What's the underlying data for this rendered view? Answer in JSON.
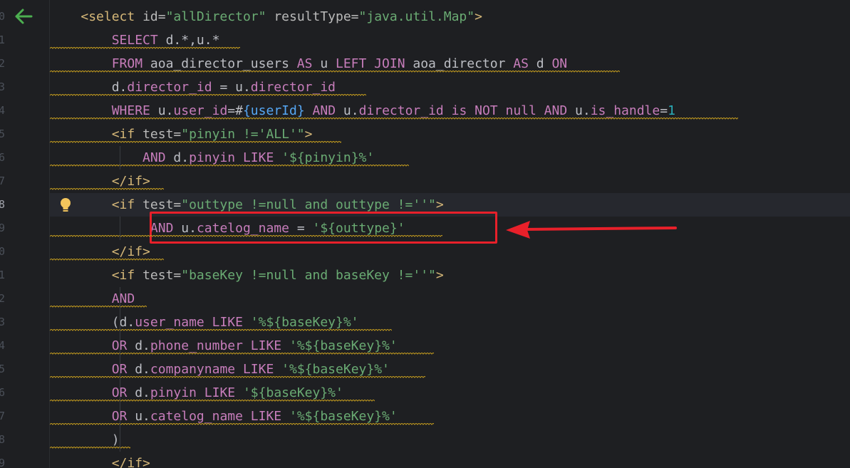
{
  "editor": {
    "current_line_index": 8,
    "gutter_numbers": [
      "0",
      "1",
      "2",
      "3",
      "4",
      "5",
      "6",
      "7",
      "8",
      "9",
      "0",
      "1",
      "2",
      "3",
      "4",
      "5",
      "6",
      "7",
      "8",
      "9"
    ],
    "lines": [
      {
        "indent": "    ",
        "tokens": [
          {
            "c": "tag",
            "t": "<select "
          },
          {
            "c": "attr",
            "t": "id="
          },
          {
            "c": "val",
            "t": "\"allDirector\""
          },
          {
            "c": "txt",
            "t": " "
          },
          {
            "c": "attr",
            "t": "resultType="
          },
          {
            "c": "val",
            "t": "\"java.util.Map\""
          },
          {
            "c": "tag",
            "t": ">"
          }
        ]
      },
      {
        "indent": "        ",
        "tokens": [
          {
            "c": "sqlkw",
            "t": "SELECT "
          },
          {
            "c": "txt",
            "t": "d.*,u.*"
          }
        ]
      },
      {
        "indent": "        ",
        "tokens": [
          {
            "c": "sqlkw",
            "t": "FROM "
          },
          {
            "c": "txt",
            "t": "aoa_director_users "
          },
          {
            "c": "sqlkw",
            "t": "AS "
          },
          {
            "c": "txt",
            "t": "u "
          },
          {
            "c": "sqlkw",
            "t": "LEFT JOIN "
          },
          {
            "c": "txt",
            "t": "aoa_director "
          },
          {
            "c": "sqlkw",
            "t": "AS "
          },
          {
            "c": "txt",
            "t": "d "
          },
          {
            "c": "sqlkw",
            "t": "ON"
          }
        ]
      },
      {
        "indent": "        ",
        "tokens": [
          {
            "c": "txt",
            "t": "d."
          },
          {
            "c": "col",
            "t": "director_id"
          },
          {
            "c": "txt",
            "t": " = u."
          },
          {
            "c": "col",
            "t": "director_id"
          }
        ]
      },
      {
        "indent": "        ",
        "tokens": [
          {
            "c": "sqlkw",
            "t": "WHERE "
          },
          {
            "c": "txt",
            "t": "u."
          },
          {
            "c": "col",
            "t": "user_id"
          },
          {
            "c": "txt",
            "t": "=#"
          },
          {
            "c": "param",
            "t": "{userId}"
          },
          {
            "c": "txt",
            "t": " "
          },
          {
            "c": "sqlkw",
            "t": "AND "
          },
          {
            "c": "txt",
            "t": "u."
          },
          {
            "c": "col",
            "t": "director_id"
          },
          {
            "c": "txt",
            "t": " "
          },
          {
            "c": "sqlkw",
            "t": "is NOT null AND "
          },
          {
            "c": "txt",
            "t": "u."
          },
          {
            "c": "col",
            "t": "is_handle"
          },
          {
            "c": "txt",
            "t": "="
          },
          {
            "c": "num",
            "t": "1"
          }
        ]
      },
      {
        "indent": "        ",
        "tokens": [
          {
            "c": "tag",
            "t": "<if "
          },
          {
            "c": "attr",
            "t": "test="
          },
          {
            "c": "val",
            "t": "\"pinyin !='ALL'\""
          },
          {
            "c": "tag",
            "t": ">"
          }
        ]
      },
      {
        "indent": "            ",
        "tokens": [
          {
            "c": "sqlkw",
            "t": "AND "
          },
          {
            "c": "txt",
            "t": "d."
          },
          {
            "c": "col",
            "t": "pinyin"
          },
          {
            "c": "txt",
            "t": " "
          },
          {
            "c": "sqlkw",
            "t": "LIKE "
          },
          {
            "c": "str",
            "t": "'${pinyin}%'"
          }
        ]
      },
      {
        "indent": "        ",
        "tokens": [
          {
            "c": "tag",
            "t": "</if>"
          }
        ]
      },
      {
        "indent": "        ",
        "tokens": [
          {
            "c": "tag",
            "t": "<if "
          },
          {
            "c": "attr",
            "t": "test="
          },
          {
            "c": "val",
            "t": "\"outtype !=null and outtype !=''\""
          },
          {
            "c": "tag",
            "t": ">"
          }
        ]
      },
      {
        "indent": "             ",
        "tokens": [
          {
            "c": "sqlkw",
            "t": "AND "
          },
          {
            "c": "txt",
            "t": "u."
          },
          {
            "c": "col",
            "t": "catelog_name"
          },
          {
            "c": "txt",
            "t": " = "
          },
          {
            "c": "str",
            "t": "'${outtype}'"
          }
        ]
      },
      {
        "indent": "        ",
        "tokens": [
          {
            "c": "tag",
            "t": "</if>"
          }
        ]
      },
      {
        "indent": "        ",
        "tokens": [
          {
            "c": "tag",
            "t": "<if "
          },
          {
            "c": "attr",
            "t": "test="
          },
          {
            "c": "val",
            "t": "\"baseKey !=null and baseKey !=''\""
          },
          {
            "c": "tag",
            "t": ">"
          }
        ]
      },
      {
        "indent": "        ",
        "tokens": [
          {
            "c": "sqlkw",
            "t": "AND"
          }
        ]
      },
      {
        "indent": "        ",
        "tokens": [
          {
            "c": "txt",
            "t": "(d."
          },
          {
            "c": "col",
            "t": "user_name"
          },
          {
            "c": "txt",
            "t": " "
          },
          {
            "c": "sqlkw",
            "t": "LIKE "
          },
          {
            "c": "str",
            "t": "'%${baseKey}%'"
          }
        ]
      },
      {
        "indent": "        ",
        "tokens": [
          {
            "c": "sqlkw",
            "t": "OR "
          },
          {
            "c": "txt",
            "t": "d."
          },
          {
            "c": "col",
            "t": "phone_number"
          },
          {
            "c": "txt",
            "t": " "
          },
          {
            "c": "sqlkw",
            "t": "LIKE "
          },
          {
            "c": "str",
            "t": "'%${baseKey}%'"
          }
        ]
      },
      {
        "indent": "        ",
        "tokens": [
          {
            "c": "sqlkw",
            "t": "OR "
          },
          {
            "c": "txt",
            "t": "d."
          },
          {
            "c": "col",
            "t": "companyname"
          },
          {
            "c": "txt",
            "t": " "
          },
          {
            "c": "sqlkw",
            "t": "LIKE "
          },
          {
            "c": "str",
            "t": "'%${baseKey}%'"
          }
        ]
      },
      {
        "indent": "        ",
        "tokens": [
          {
            "c": "sqlkw",
            "t": "OR "
          },
          {
            "c": "txt",
            "t": "d."
          },
          {
            "c": "col",
            "t": "pinyin"
          },
          {
            "c": "txt",
            "t": " "
          },
          {
            "c": "sqlkw",
            "t": "LIKE "
          },
          {
            "c": "str",
            "t": "'${baseKey}%'"
          }
        ]
      },
      {
        "indent": "        ",
        "tokens": [
          {
            "c": "sqlkw",
            "t": "OR "
          },
          {
            "c": "txt",
            "t": "u."
          },
          {
            "c": "col",
            "t": "catelog_name"
          },
          {
            "c": "txt",
            "t": " "
          },
          {
            "c": "sqlkw",
            "t": "LIKE "
          },
          {
            "c": "str",
            "t": "'%${baseKey}%'"
          }
        ]
      },
      {
        "indent": "        ",
        "tokens": [
          {
            "c": "txt",
            "t": ")"
          }
        ]
      },
      {
        "indent": "        ",
        "tokens": [
          {
            "c": "tag",
            "t": "</if>"
          }
        ]
      }
    ],
    "warning_lines": [
      1,
      2,
      3,
      4,
      5,
      6,
      7,
      9,
      10,
      12,
      13,
      14,
      15,
      16,
      17,
      18,
      19
    ],
    "icons": {
      "back": "arrow-left-icon",
      "bulb": "lightbulb-icon"
    },
    "colors": {
      "background": "#1e1f22",
      "annotation": "#e8202a",
      "warning": "#c29a1f"
    }
  }
}
